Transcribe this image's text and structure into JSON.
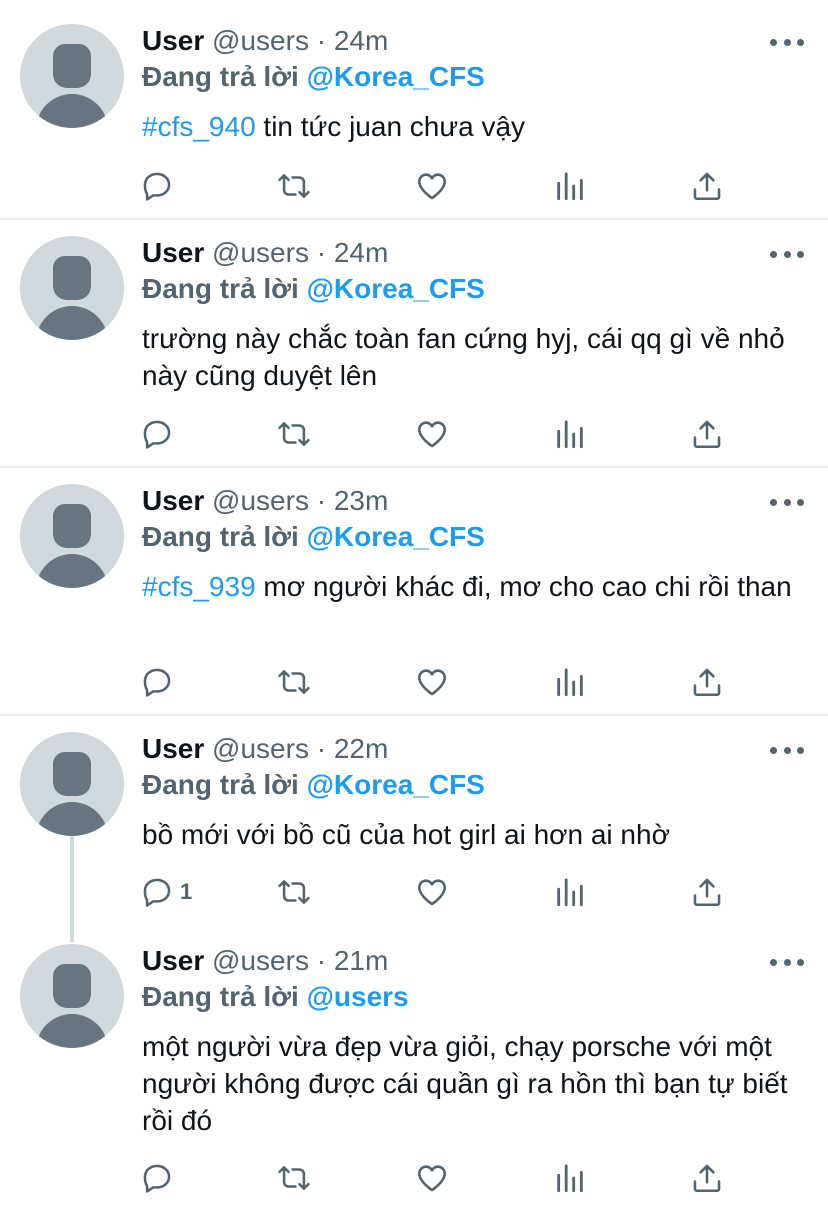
{
  "tweets": [
    {
      "name": "User",
      "handle": "@users",
      "dot": "·",
      "time": "24m",
      "replying_label": "Đang trả lời",
      "replying_to": "@Korea_CFS",
      "hashtag": "#cfs_940",
      "text": " tin tức juan chưa vậy",
      "reply_count": ""
    },
    {
      "name": "User",
      "handle": "@users",
      "dot": "·",
      "time": "24m",
      "replying_label": "Đang trả lời",
      "replying_to": "@Korea_CFS",
      "hashtag": "",
      "text": "trường này chắc toàn fan cứng hyj, cái qq gì về nhỏ này cũng duyệt lên",
      "reply_count": ""
    },
    {
      "name": "User",
      "handle": "@users",
      "dot": "·",
      "time": "23m",
      "replying_label": "Đang trả lời",
      "replying_to": "@Korea_CFS",
      "hashtag": "#cfs_939",
      "text": " mơ người khác đi, mơ cho cao chi rồi than",
      "reply_count": ""
    },
    {
      "name": "User",
      "handle": "@users",
      "dot": "·",
      "time": "22m",
      "replying_label": "Đang trả lời",
      "replying_to": "@Korea_CFS",
      "hashtag": "",
      "text": "bồ mới với bồ cũ của hot girl ai hơn ai nhờ",
      "reply_count": "1"
    },
    {
      "name": "User",
      "handle": "@users",
      "dot": "·",
      "time": "21m",
      "replying_label": "Đang trả lời",
      "replying_to": "@users",
      "hashtag": "",
      "text": "một người vừa đẹp vừa giỏi, chạy porsche với một người không được cái quần gì ra hồn thì bạn tự biết rồi đó",
      "reply_count": ""
    }
  ],
  "icons": {
    "more": "more-horizontal-icon",
    "reply": "reply-bubble-icon",
    "retweet": "retweet-icon",
    "like": "heart-icon",
    "views": "bar-chart-icon",
    "share": "share-upload-icon"
  },
  "colors": {
    "accent": "#1d9bf0",
    "secondary_text": "#536471",
    "divider": "#e6ecf0",
    "avatar_bg": "#cfd9de",
    "avatar_fg": "#66757f"
  }
}
